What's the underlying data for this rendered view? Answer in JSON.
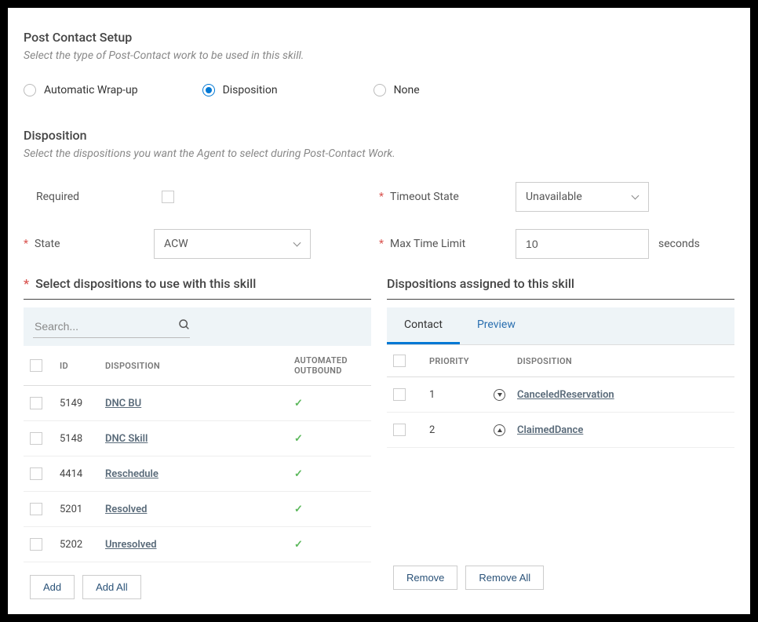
{
  "header": {
    "title": "Post Contact Setup",
    "subtitle": "Select the type of Post-Contact work to be used in this skill."
  },
  "post_contact_options": {
    "automatic": "Automatic Wrap-up",
    "disposition": "Disposition",
    "none": "None",
    "selected": "disposition"
  },
  "disposition_section": {
    "title": "Disposition",
    "subtitle": "Select the dispositions you want the Agent to select during Post-Contact Work."
  },
  "fields": {
    "required_label": "Required",
    "timeout_state_label": "Timeout State",
    "timeout_state_value": "Unavailable",
    "state_label": "State",
    "state_value": "ACW",
    "max_time_label": "Max Time Limit",
    "max_time_value": "10",
    "max_time_unit": "seconds"
  },
  "left_panel": {
    "title": "Select dispositions to use with this skill",
    "search_placeholder": "Search...",
    "columns": {
      "id": "ID",
      "disposition": "DISPOSITION",
      "automated": "AUTOMATED OUTBOUND"
    },
    "rows": [
      {
        "id": "5149",
        "name": "DNC BU",
        "automated": true
      },
      {
        "id": "5148",
        "name": "DNC Skill",
        "automated": true
      },
      {
        "id": "4414",
        "name": "Reschedule",
        "automated": true
      },
      {
        "id": "5201",
        "name": "Resolved",
        "automated": true
      },
      {
        "id": "5202",
        "name": "Unresolved",
        "automated": true
      }
    ],
    "buttons": {
      "add": "Add",
      "add_all": "Add All"
    }
  },
  "right_panel": {
    "title": "Dispositions assigned to this skill",
    "tabs": {
      "contact": "Contact",
      "preview": "Preview"
    },
    "columns": {
      "priority": "PRIORITY",
      "disposition": "DISPOSITION"
    },
    "rows": [
      {
        "priority": "1",
        "name": "CanceledReservation",
        "dir": "down"
      },
      {
        "priority": "2",
        "name": "ClaimedDance",
        "dir": "up"
      }
    ],
    "buttons": {
      "remove": "Remove",
      "remove_all": "Remove All"
    }
  }
}
